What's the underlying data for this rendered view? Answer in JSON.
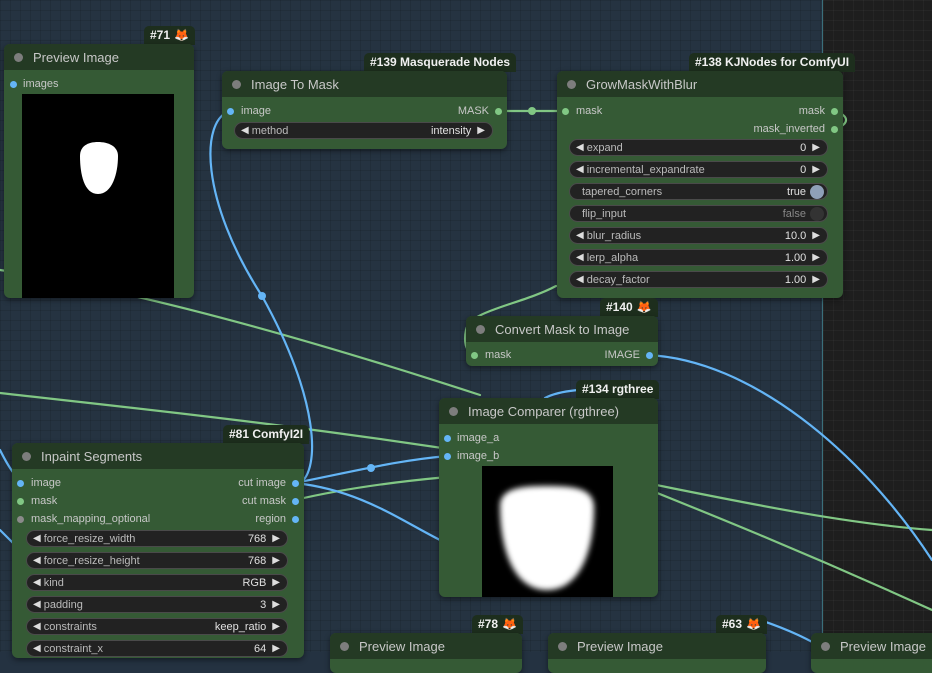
{
  "colors": {
    "node_body": "#355a35",
    "node_title": "#243a24",
    "wire_image": "#64b5f6",
    "wire_mask": "#81c784",
    "canvas": "#253341"
  },
  "nodes": {
    "preview71": {
      "badge": "#71",
      "badge_icon": "fox-icon",
      "title": "Preview Image",
      "input_images": "images"
    },
    "imageToMask": {
      "badge": "#139 Masquerade Nodes",
      "title": "Image To Mask",
      "input_image": "image",
      "output_mask": "MASK",
      "method_label": "method",
      "method_value": "intensity"
    },
    "grow": {
      "badge": "#138 KJNodes for ComfyUI",
      "title": "GrowMaskWithBlur",
      "input_mask": "mask",
      "output_mask": "mask",
      "output_mask_inverted": "mask_inverted",
      "expand_label": "expand",
      "expand_value": "0",
      "incr_label": "incremental_expandrate",
      "incr_value": "0",
      "tapered_label": "tapered_corners",
      "tapered_value": "true",
      "flip_label": "flip_input",
      "flip_value": "false",
      "blur_label": "blur_radius",
      "blur_value": "10.0",
      "lerp_label": "lerp_alpha",
      "lerp_value": "1.00",
      "decay_label": "decay_factor",
      "decay_value": "1.00"
    },
    "convert": {
      "badge": "#140",
      "badge_icon": "fox-icon",
      "title": "Convert Mask to Image",
      "input_mask": "mask",
      "output_image": "IMAGE"
    },
    "comparer": {
      "badge": "#134 rgthree",
      "title": "Image Comparer (rgthree)",
      "input_a": "image_a",
      "input_b": "image_b"
    },
    "inpaint": {
      "badge": "#81 ComfyI2I",
      "title": "Inpaint Segments",
      "input_image": "image",
      "input_mask": "mask",
      "input_mapping": "mask_mapping_optional",
      "output_cut_image": "cut image",
      "output_cut_mask": "cut mask",
      "output_region": "region",
      "w1_label": "force_resize_width",
      "w1_value": "768",
      "w2_label": "force_resize_height",
      "w2_value": "768",
      "w3_label": "kind",
      "w3_value": "RGB",
      "w4_label": "padding",
      "w4_value": "3",
      "w5_label": "constraints",
      "w5_value": "keep_ratio",
      "w6_label": "constraint_x",
      "w6_value": "64"
    },
    "preview78": {
      "badge": "#78",
      "badge_icon": "fox-icon",
      "title": "Preview Image"
    },
    "preview63": {
      "badge": "#63",
      "badge_icon": "fox-icon",
      "title": "Preview Image"
    },
    "previewRight": {
      "title": "Preview Image"
    }
  }
}
